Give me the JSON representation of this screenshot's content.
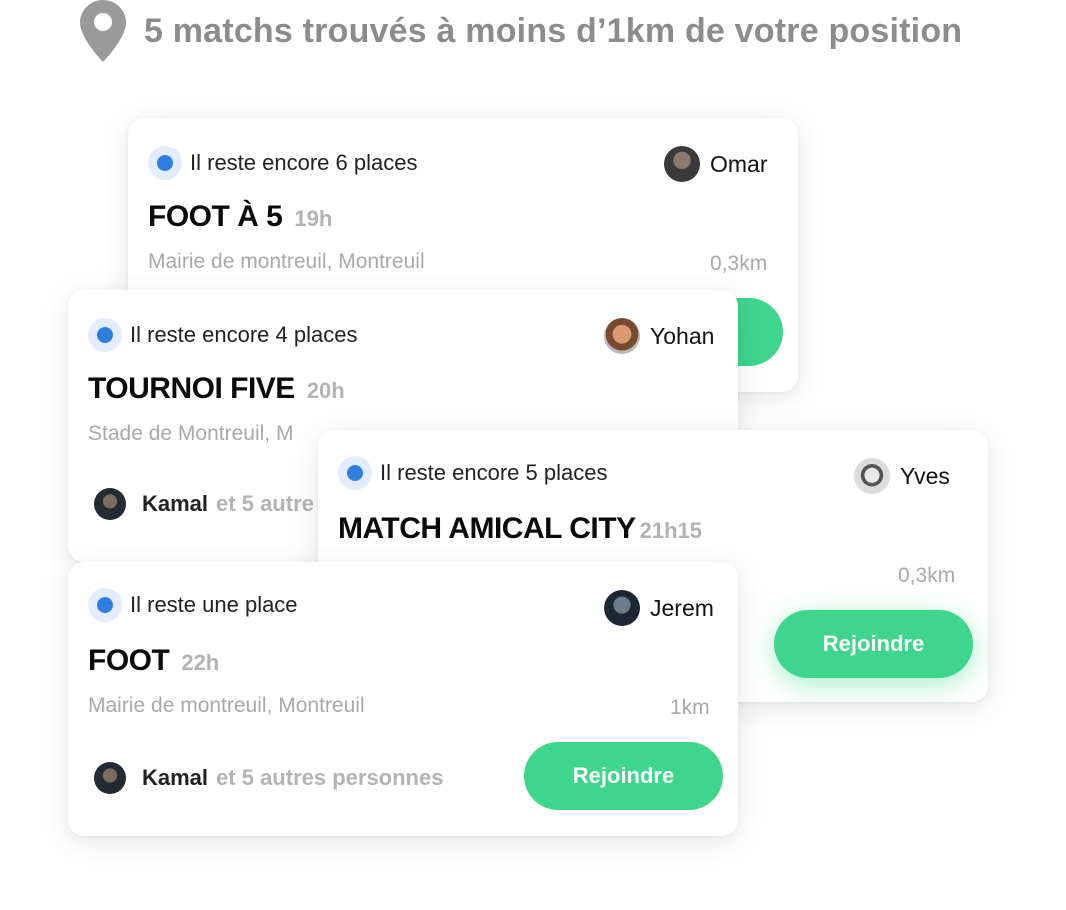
{
  "header": {
    "title": "5 matchs trouvés à moins d’1km de votre position",
    "icon": "location-pin-icon"
  },
  "colors": {
    "accent": "#3dd68c",
    "status_dot": "#2f7fe0",
    "muted_text": "#a9a9a9",
    "header_text": "#8c8c8c"
  },
  "cards": [
    {
      "status": "Il reste encore 6 places",
      "host": "Omar",
      "title": "FOOT À 5",
      "time": "19h",
      "location": "Mairie de montreuil, Montreuil",
      "distance": "0,3km"
    },
    {
      "status": "Il reste encore 4 places",
      "host": "Yohan",
      "title": "TOURNOI FIVE",
      "time": "20h",
      "location": "Stade de Montreuil, M",
      "participant": "Kamal",
      "others": "et 5 autre"
    },
    {
      "status": "Il reste encore 5 places",
      "host": "Yves",
      "title": "MATCH AMICAL CITY",
      "time": "21h15",
      "distance": "0,3km",
      "button": "Rejoindre"
    },
    {
      "status": "Il reste une place",
      "host": "Jerem",
      "title": "FOOT",
      "time": "22h",
      "location": "Mairie de montreuil, Montreuil",
      "distance": "1km",
      "participant": "Kamal",
      "others": "et 5 autres personnes",
      "button": "Rejoindre"
    }
  ]
}
